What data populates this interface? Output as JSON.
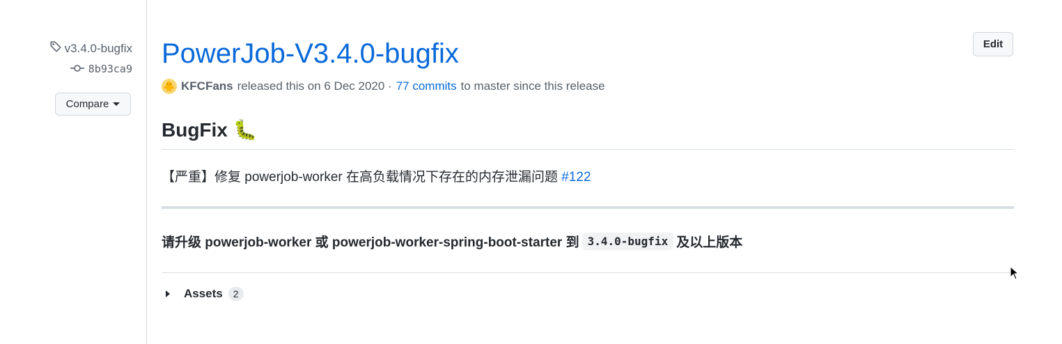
{
  "sidebar": {
    "tag_label": "v3.4.0-bugfix",
    "commit_sha": "8b93ca9",
    "compare_label": "Compare"
  },
  "release": {
    "title": "PowerJob-V3.4.0-bugfix",
    "edit_label": "Edit",
    "author": "KFCFans",
    "released_text": "released this on 6 Dec 2020 ·",
    "commits_link": "77 commits",
    "commits_suffix": "to master since this release"
  },
  "body": {
    "heading": "BugFix",
    "heading_emoji": "🐛",
    "fix_text": "【严重】修复 powerjob-worker 在高负载情况下存在的内存泄漏问题",
    "fix_issue": "#122",
    "upgrade_prefix": "请升级 powerjob-worker 或 powerjob-worker-spring-boot-starter 到",
    "upgrade_version": "3.4.0-bugfix",
    "upgrade_suffix": "及以上版本"
  },
  "assets": {
    "label": "Assets",
    "count": "2"
  },
  "colors": {
    "link": "#0969da",
    "text": "#24292f",
    "muted": "#57606a"
  }
}
